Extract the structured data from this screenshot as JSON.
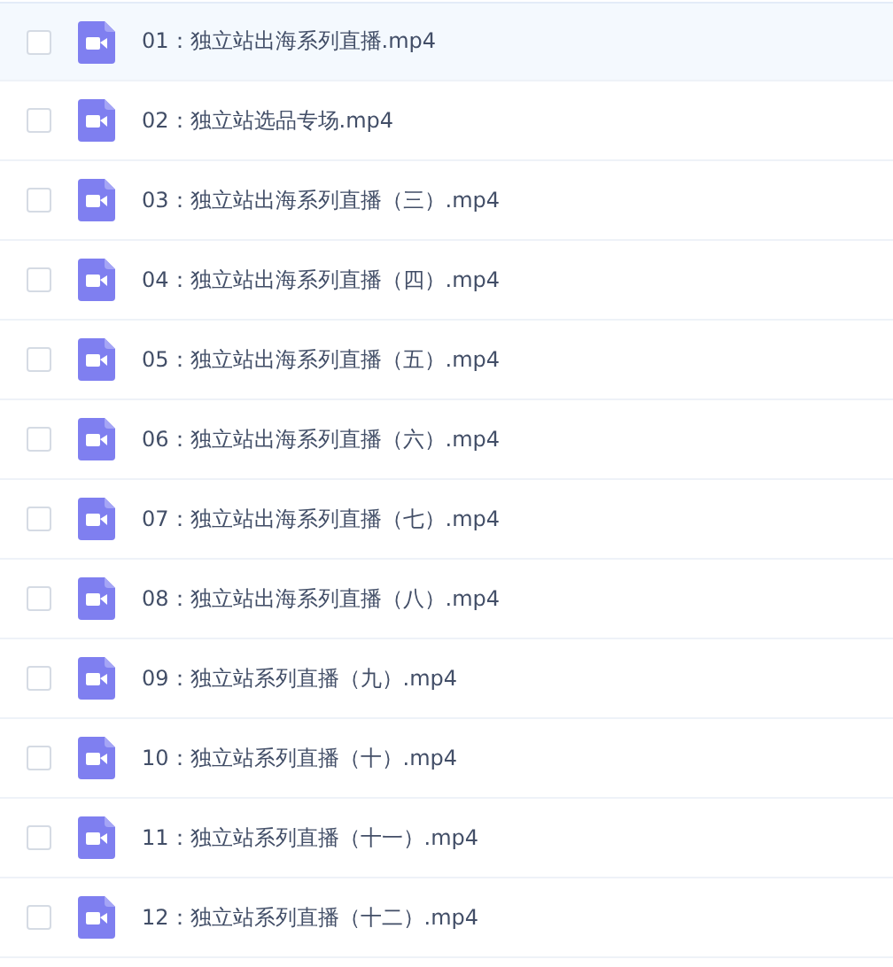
{
  "files": [
    {
      "name": "01：独立站出海系列直播.mp4",
      "selected": true,
      "checked": false
    },
    {
      "name": "02：独立站选品专场.mp4",
      "selected": false,
      "checked": false
    },
    {
      "name": "03：独立站出海系列直播（三）.mp4",
      "selected": false,
      "checked": false
    },
    {
      "name": "04：独立站出海系列直播（四）.mp4",
      "selected": false,
      "checked": false
    },
    {
      "name": "05：独立站出海系列直播（五）.mp4",
      "selected": false,
      "checked": false
    },
    {
      "name": "06：独立站出海系列直播（六）.mp4",
      "selected": false,
      "checked": false
    },
    {
      "name": "07：独立站出海系列直播（七）.mp4",
      "selected": false,
      "checked": false
    },
    {
      "name": "08：独立站出海系列直播（八）.mp4",
      "selected": false,
      "checked": false
    },
    {
      "name": "09：独立站系列直播（九）.mp4",
      "selected": false,
      "checked": false
    },
    {
      "name": "10：独立站系列直播（十）.mp4",
      "selected": false,
      "checked": false
    },
    {
      "name": "11：独立站系列直播（十一）.mp4",
      "selected": false,
      "checked": false
    },
    {
      "name": "12：独立站系列直播（十二）.mp4",
      "selected": false,
      "checked": false
    }
  ]
}
